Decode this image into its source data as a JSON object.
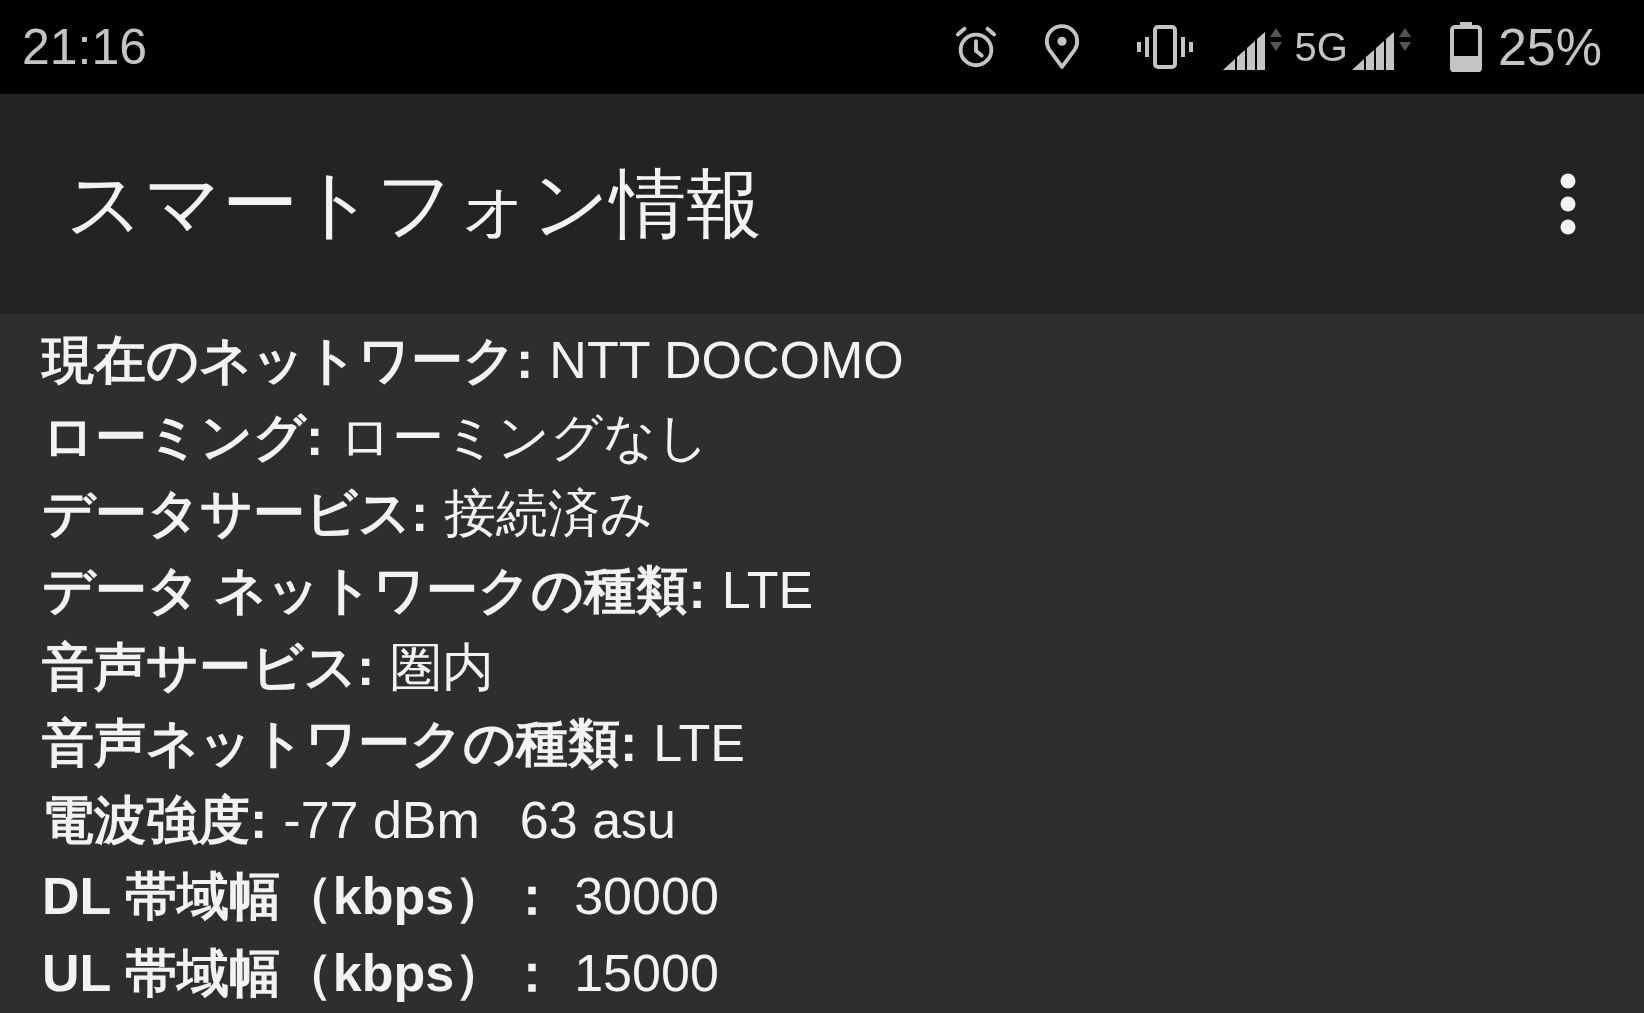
{
  "status_bar": {
    "time": "21:16",
    "network_type": "5G",
    "battery_percent": "25%"
  },
  "app_bar": {
    "title": "スマートフォン情報"
  },
  "info_rows": [
    {
      "label": "現在のネットワーク:",
      "values": [
        "NTT DOCOMO"
      ]
    },
    {
      "label": "ローミング:",
      "values": [
        "ローミングなし"
      ]
    },
    {
      "label": "データサービス:",
      "values": [
        "接続済み"
      ]
    },
    {
      "label": "データ ネットワークの種類:",
      "values": [
        "LTE"
      ]
    },
    {
      "label": "音声サービス:",
      "values": [
        "圏内"
      ]
    },
    {
      "label": "音声ネットワークの種類:",
      "values": [
        "LTE"
      ]
    },
    {
      "label": "電波強度:",
      "values": [
        "-77 dBm",
        "63 asu"
      ]
    },
    {
      "label": "DL 帯域幅（kbps）：",
      "values": [
        "30000"
      ]
    },
    {
      "label": "UL 帯域幅（kbps）：",
      "values": [
        "15000"
      ]
    }
  ]
}
